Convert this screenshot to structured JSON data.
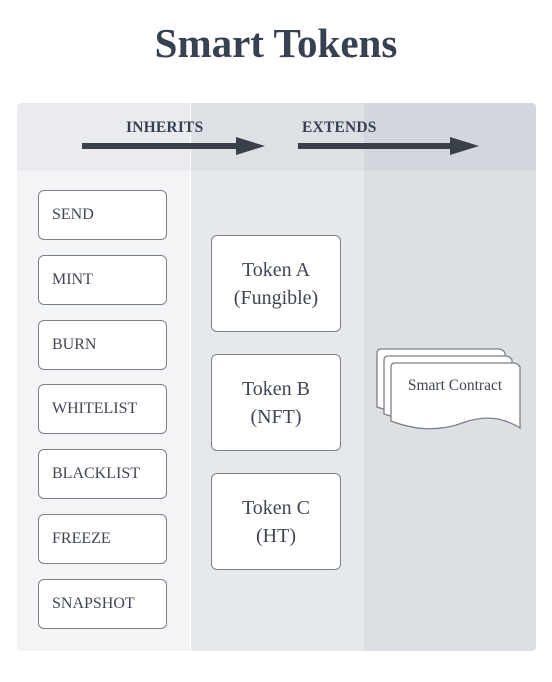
{
  "title": "Smart Tokens",
  "header": {
    "inherits_label": "INHERITS",
    "extends_label": "EXTENDS"
  },
  "operations": [
    {
      "label": "SEND"
    },
    {
      "label": "MINT"
    },
    {
      "label": "BURN"
    },
    {
      "label": "WHITELIST"
    },
    {
      "label": "BLACKLIST"
    },
    {
      "label": "FREEZE"
    },
    {
      "label": "SNAPSHOT"
    }
  ],
  "tokens": [
    {
      "name": "Token A",
      "type": "(Fungible)"
    },
    {
      "name": "Token B",
      "type": "(NFT)"
    },
    {
      "name": "Token C",
      "type": "(HT)"
    }
  ],
  "contract": {
    "label": "Smart Contract",
    "icon": "multi-document-icon"
  },
  "colors": {
    "text": "#374151",
    "arrow": "#3a404a",
    "box_border": "#7b8088"
  }
}
